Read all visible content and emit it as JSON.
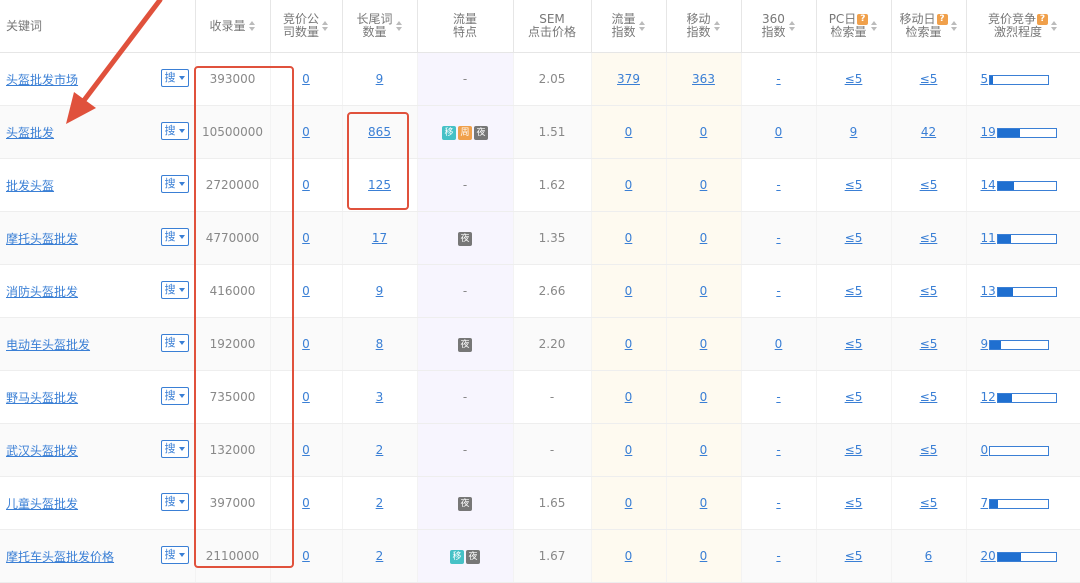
{
  "headers": {
    "keyword": "关键词",
    "shoulu": "收录量",
    "bid_companies": [
      "竞价公",
      "司数量"
    ],
    "longtail": [
      "长尾词",
      "数量"
    ],
    "traffic_feature": [
      "流量",
      "特点"
    ],
    "sem": [
      "SEM",
      "点击价格"
    ],
    "traffic_index": [
      "流量",
      "指数"
    ],
    "mobile_index": [
      "移动",
      "指数"
    ],
    "index360": [
      "360",
      "指数"
    ],
    "pc_daily": [
      "PC日",
      "检索量"
    ],
    "mobile_daily": [
      "移动日",
      "检索量"
    ],
    "competition": [
      "竞价竞争",
      "激烈程度"
    ],
    "help_icon_text": "?"
  },
  "search_button_label": "搜",
  "highlight_term": "头盔批发",
  "colors": {
    "link": "#3a7fd5",
    "annotation": "#e0513c",
    "tag_mobile": "#46c1c6",
    "tag_week": "#f0a04b",
    "tag_night": "#777777"
  },
  "rows": [
    {
      "pre": "",
      "hl": "头盔批发",
      "post": "市场",
      "shoulu": "393000",
      "companies": "0",
      "longtail": "9",
      "tags": [],
      "feat": "-",
      "sem": "2.05",
      "traffic": "379",
      "mobile": "363",
      "i360": "-",
      "pc": "≤5",
      "mob": "≤5",
      "comp": "5",
      "comp_level": 0.05
    },
    {
      "pre": "",
      "hl": "头盔批发",
      "post": "",
      "shoulu": "10500000",
      "companies": "0",
      "longtail": "865",
      "tags": [
        {
          "t": "移",
          "c": "t-yi"
        },
        {
          "t": "周",
          "c": "t-zhou"
        },
        {
          "t": "夜",
          "c": "t-ye"
        }
      ],
      "feat": "",
      "sem": "1.51",
      "traffic": "0",
      "mobile": "0",
      "i360": "0",
      "pc": "9",
      "mob": "42",
      "comp": "19",
      "comp_level": 0.38
    },
    {
      "pre": "",
      "hl": "批发头盔",
      "post": "",
      "shoulu": "2720000",
      "companies": "0",
      "longtail": "125",
      "tags": [],
      "feat": "-",
      "sem": "1.62",
      "traffic": "0",
      "mobile": "0",
      "i360": "-",
      "pc": "≤5",
      "mob": "≤5",
      "comp": "14",
      "comp_level": 0.28
    },
    {
      "pre": "摩托",
      "hl": "头盔批发",
      "post": "",
      "shoulu": "4770000",
      "companies": "0",
      "longtail": "17",
      "tags": [
        {
          "t": "夜",
          "c": "t-ye"
        }
      ],
      "feat": "",
      "sem": "1.35",
      "traffic": "0",
      "mobile": "0",
      "i360": "-",
      "pc": "≤5",
      "mob": "≤5",
      "comp": "11",
      "comp_level": 0.22
    },
    {
      "pre": "消防",
      "hl": "头盔批发",
      "post": "",
      "shoulu": "416000",
      "companies": "0",
      "longtail": "9",
      "tags": [],
      "feat": "-",
      "sem": "2.66",
      "traffic": "0",
      "mobile": "0",
      "i360": "-",
      "pc": "≤5",
      "mob": "≤5",
      "comp": "13",
      "comp_level": 0.26
    },
    {
      "pre": "电动车",
      "hl": "头盔批发",
      "post": "",
      "shoulu": "192000",
      "companies": "0",
      "longtail": "8",
      "tags": [
        {
          "t": "夜",
          "c": "t-ye"
        }
      ],
      "feat": "",
      "sem": "2.20",
      "traffic": "0",
      "mobile": "0",
      "i360": "0",
      "pc": "≤5",
      "mob": "≤5",
      "comp": "9",
      "comp_level": 0.18
    },
    {
      "pre": "野马",
      "hl": "头盔批发",
      "post": "",
      "shoulu": "735000",
      "companies": "0",
      "longtail": "3",
      "tags": [],
      "feat": "-",
      "sem": "-",
      "traffic": "0",
      "mobile": "0",
      "i360": "-",
      "pc": "≤5",
      "mob": "≤5",
      "comp": "12",
      "comp_level": 0.24
    },
    {
      "pre": "武汉",
      "hl": "头盔批发",
      "post": "",
      "shoulu": "132000",
      "companies": "0",
      "longtail": "2",
      "tags": [],
      "feat": "-",
      "sem": "-",
      "traffic": "0",
      "mobile": "0",
      "i360": "-",
      "pc": "≤5",
      "mob": "≤5",
      "comp": "0",
      "comp_level": 0.0
    },
    {
      "pre": "儿童",
      "hl": "头盔批发",
      "post": "",
      "shoulu": "397000",
      "companies": "0",
      "longtail": "2",
      "tags": [
        {
          "t": "夜",
          "c": "t-ye"
        }
      ],
      "feat": "",
      "sem": "1.65",
      "traffic": "0",
      "mobile": "0",
      "i360": "-",
      "pc": "≤5",
      "mob": "≤5",
      "comp": "7",
      "comp_level": 0.14
    },
    {
      "pre": "摩托车",
      "hl": "头盔批发",
      "post": "价格",
      "shoulu": "2110000",
      "companies": "0",
      "longtail": "2",
      "tags": [
        {
          "t": "移",
          "c": "t-yi"
        },
        {
          "t": "夜",
          "c": "t-ye"
        }
      ],
      "feat": "",
      "sem": "1.67",
      "traffic": "0",
      "mobile": "0",
      "i360": "-",
      "pc": "≤5",
      "mob": "6",
      "comp": "20",
      "comp_level": 0.4
    }
  ]
}
